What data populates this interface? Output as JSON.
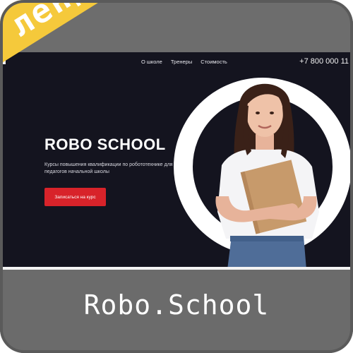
{
  "ribbon": {
    "label": "лендинг"
  },
  "site": {
    "nav": [
      "О школе",
      "Тренеры",
      "Стоимость"
    ],
    "phone": "+7 800 000 11"
  },
  "hero": {
    "title": "ROBO SCHOOL",
    "subtitle": "Курсы повышения квалификации по робототехнике для педагогов начальной школы",
    "cta_label": "Записаться на курс"
  },
  "caption": {
    "title": "Robo.School"
  },
  "colors": {
    "ribbon": "#f5c93b",
    "hero_bg": "#14141f",
    "cta": "#d8232a",
    "frame": "#6d6d6d"
  }
}
